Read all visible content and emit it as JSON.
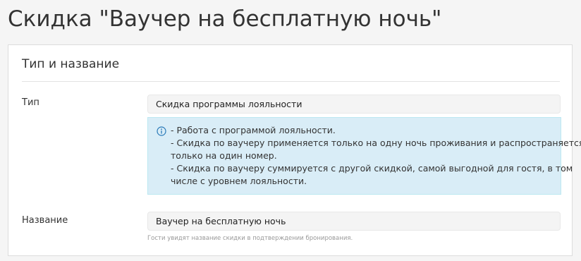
{
  "page": {
    "title": "Скидка \"Ваучер на бесплатную ночь\""
  },
  "section": {
    "title": "Тип и название"
  },
  "type_field": {
    "label": "Тип",
    "value": "Скидка программы лояльности"
  },
  "info": {
    "icon": "info-circle-icon",
    "color": "#2a7ab8",
    "lines": [
      "- Работа с программой лояльности.",
      "- Скидка по ваучеру применяется только на одну ночь проживания и распространяется",
      "только на один номер.",
      "- Скидка по ваучеру суммируется с другой скидкой, самой выгодной для гостя, в том",
      "числе с уровнем лояльности."
    ]
  },
  "name_field": {
    "label": "Название",
    "value": "Ваучер на бесплатную ночь",
    "help": "Гости увидят название скидки в подтверждении бронирования."
  }
}
